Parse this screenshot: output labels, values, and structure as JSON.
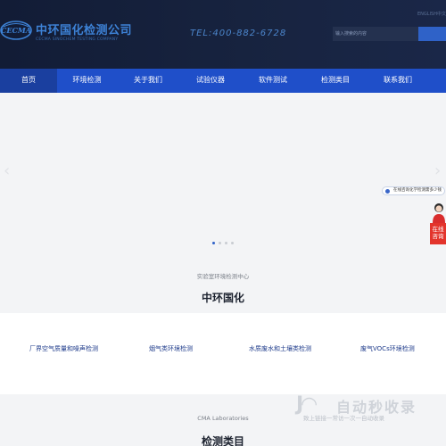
{
  "header": {
    "brand_name": "中环国化检测公司",
    "brand_sub": "CECMA SINOCHEM TESTING COMPANY",
    "logo_text": "CECMA",
    "phone": "TEL:400-882-6728",
    "lang_switch": "ENGLISH中文",
    "search_placeholder": "输入搜索的内容"
  },
  "nav": {
    "items": [
      {
        "label": "首页",
        "active": true
      },
      {
        "label": "环境检测"
      },
      {
        "label": "关于我们"
      },
      {
        "label": "试验仪器"
      },
      {
        "label": "软件测试"
      },
      {
        "label": "检测类目"
      },
      {
        "label": "联系我们"
      }
    ]
  },
  "banner": {
    "slide_count": 4,
    "active_slide": 1
  },
  "floating": {
    "chat_text": "在线咨询化学检测需多少钱",
    "online_label_1": "在线",
    "online_label_2": "咨询"
  },
  "lab_section": {
    "subtitle": "实验室环境检测中心",
    "title": "中环国化",
    "services": [
      "厂界空气质量和噪声检测",
      "烟气类环境检测",
      "水质废水和土壤类检测",
      "废气VOCs环境检测"
    ]
  },
  "cma_section": {
    "subtitle": "CMA Laboratories",
    "title": "检测类目"
  },
  "watermark": {
    "name": "自动秒收录",
    "tagline": "致上链接一常访一次一自动收录"
  },
  "colors": {
    "header_bg": "#17233f",
    "nav_bg": "#1f4fc9",
    "accent": "#2f62c8",
    "online_red": "#e3342c"
  }
}
